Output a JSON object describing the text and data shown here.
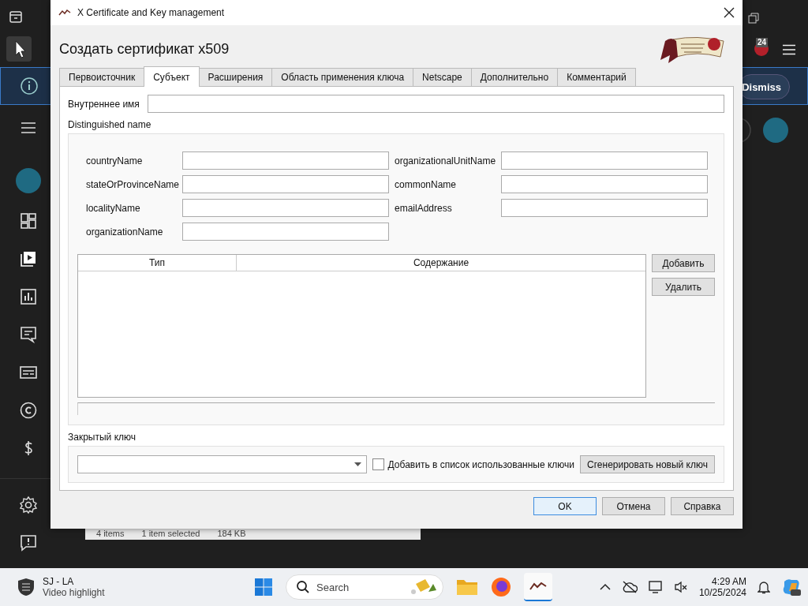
{
  "background_app": {
    "banner": {
      "button": "Dismiss"
    },
    "notification_badge": "24"
  },
  "explorer_status": {
    "items": "4 items",
    "selected": "1 item selected",
    "size": "184 KB"
  },
  "dialog": {
    "title": "X Certificate and Key management",
    "heading": "Создать сертификат x509",
    "tabs": [
      {
        "label": "Первоисточник",
        "selected": false
      },
      {
        "label": "Субъект",
        "selected": true
      },
      {
        "label": "Расширения",
        "selected": false
      },
      {
        "label": "Область применения ключа",
        "selected": false
      },
      {
        "label": "Netscape",
        "selected": false
      },
      {
        "label": "Дополнительно",
        "selected": false
      },
      {
        "label": "Комментарий",
        "selected": false
      }
    ],
    "internal_name": {
      "label": "Внутреннее имя"
    },
    "dn_title": "Distinguished name",
    "dn_left": [
      {
        "label": "countryName"
      },
      {
        "label": "stateOrProvinceName"
      },
      {
        "label": "localityName"
      },
      {
        "label": "organizationName"
      }
    ],
    "dn_right": [
      {
        "label": "organizationalUnitName"
      },
      {
        "label": "commonName"
      },
      {
        "label": "emailAddress"
      }
    ],
    "table": {
      "columns": [
        "Тип",
        "Содержание"
      ]
    },
    "table_buttons": [
      "Добавить",
      "Удалить"
    ],
    "private_key": {
      "title": "Закрытый ключ",
      "checkbox": {
        "label": "Добавить в список использованные ключи",
        "checked": false
      },
      "generate_button": "Сгенерировать новый ключ"
    },
    "buttons": [
      {
        "label": "OK",
        "default": true
      },
      {
        "label": "Отмена",
        "default": false
      },
      {
        "label": "Справка",
        "default": false
      }
    ]
  },
  "taskbar": {
    "news": {
      "title": "SJ - LA",
      "subtitle": "Video highlight"
    },
    "search": {
      "placeholder": "Search"
    },
    "time": "4:29 AM",
    "date": "10/25/2024"
  }
}
